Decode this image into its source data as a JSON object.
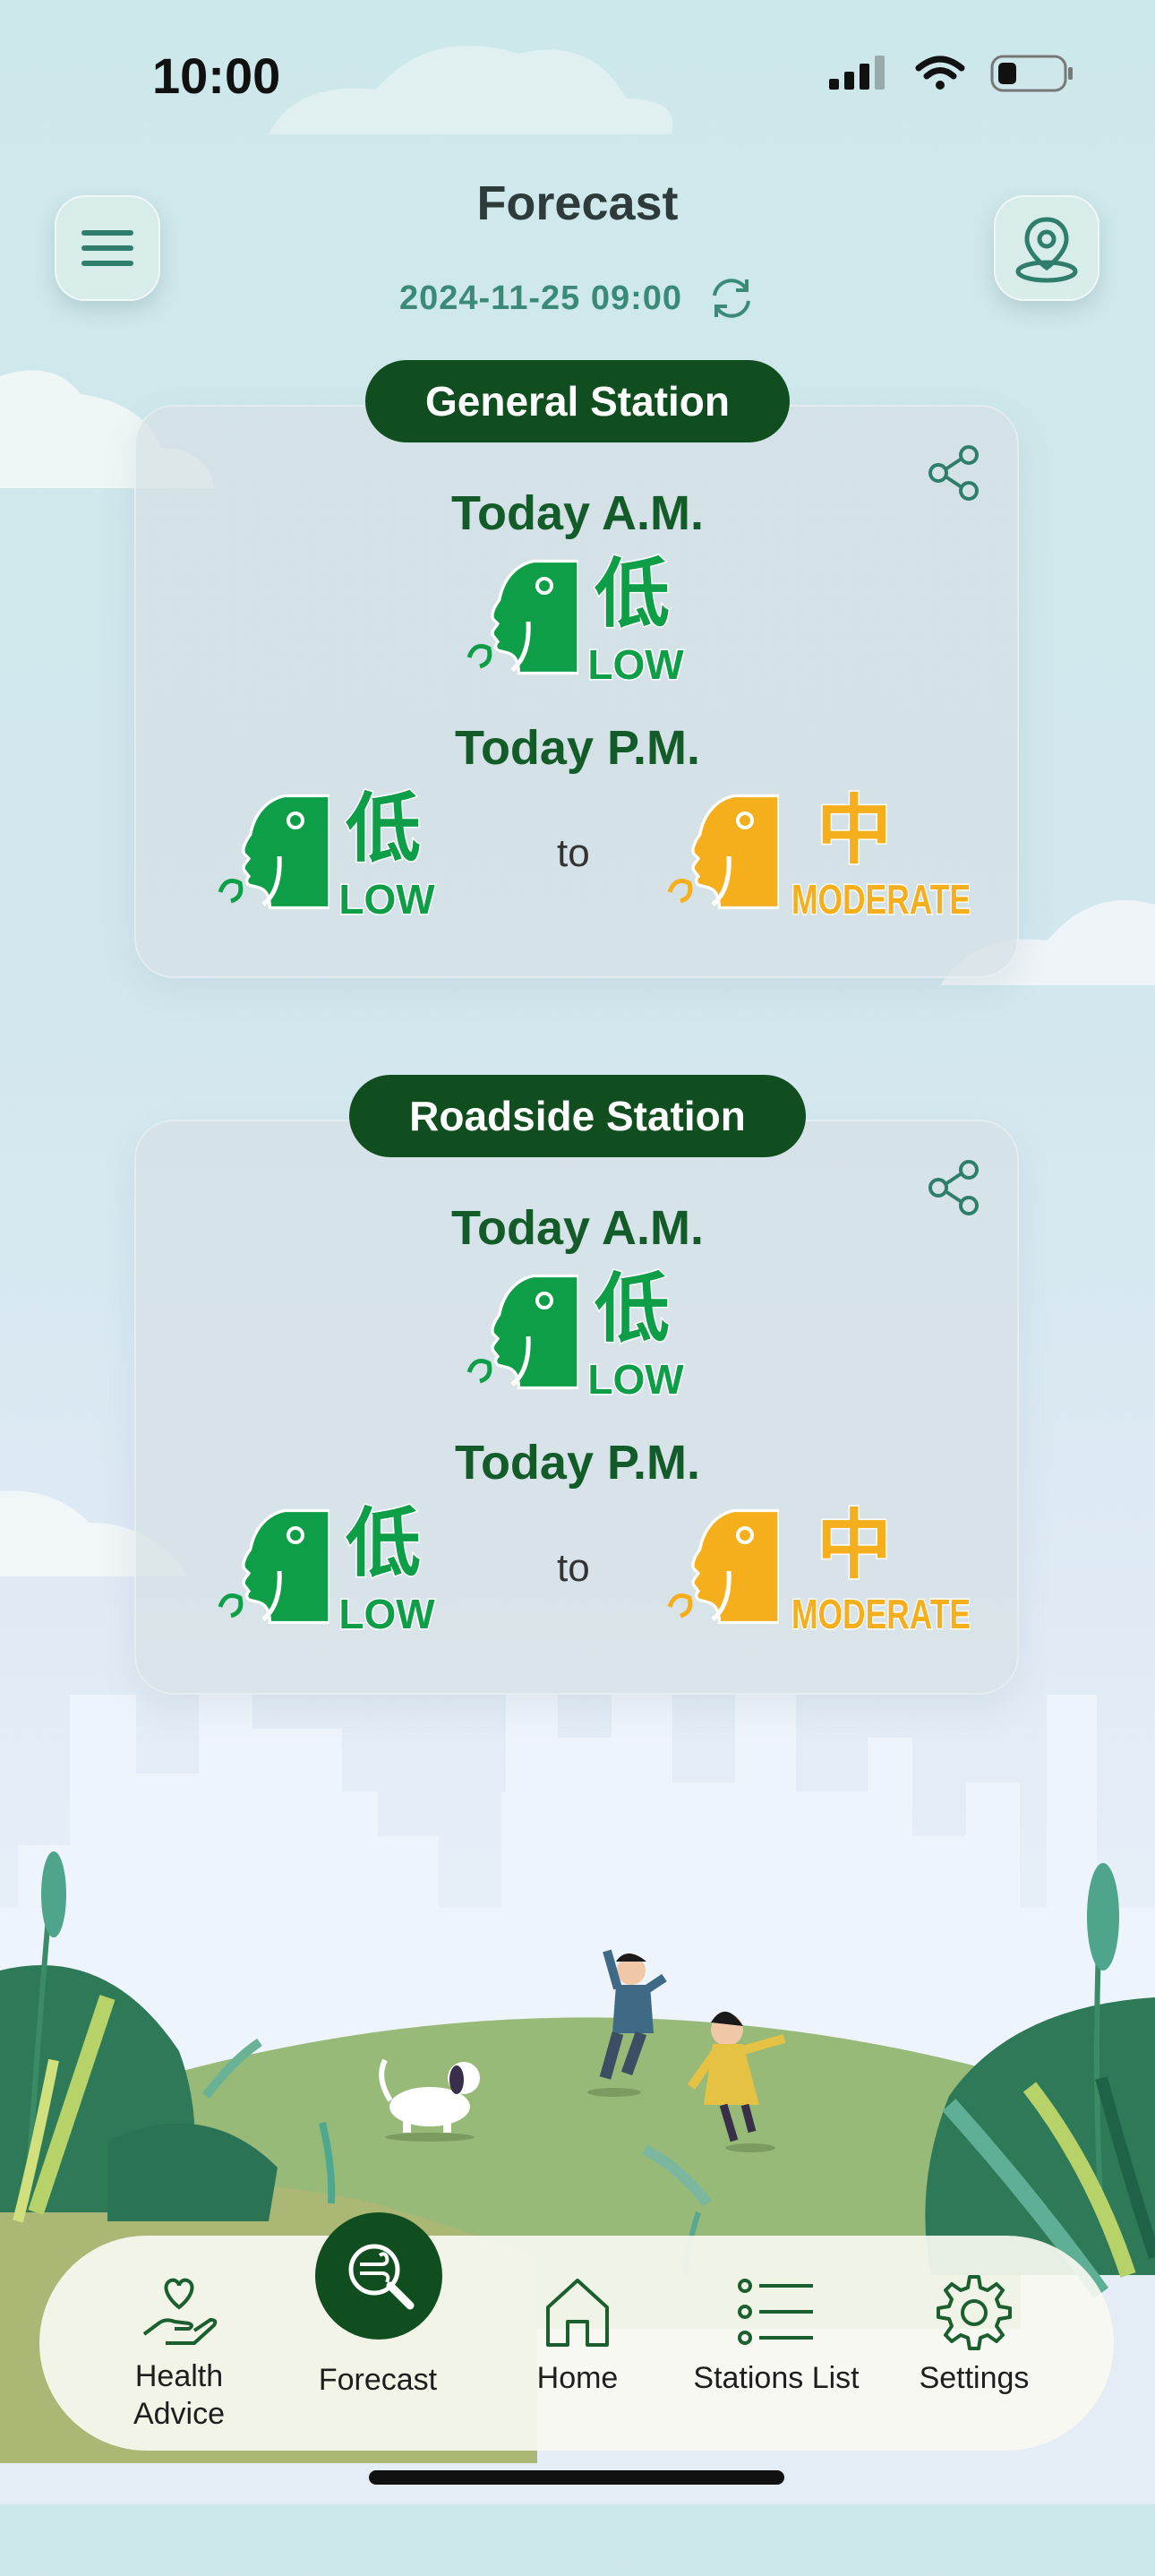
{
  "status_bar": {
    "time": "10:00"
  },
  "header": {
    "title": "Forecast",
    "datetime": "2024-11-25 09:00",
    "menu_icon": "hamburger-icon",
    "location_icon": "location-pin-icon",
    "refresh_icon": "refresh-icon"
  },
  "stations": [
    {
      "name": "General Station",
      "am_label": "Today A.M.",
      "am_level": {
        "char": "低",
        "text": "LOW",
        "color": "#0e9e47"
      },
      "pm_label": "Today P.M.",
      "pm_from": {
        "char": "低",
        "text": "LOW",
        "color": "#0e9e47"
      },
      "to_text": "to",
      "pm_to": {
        "char": "中",
        "text": "MODERATE",
        "color": "#f5ae1c"
      }
    },
    {
      "name": "Roadside Station",
      "am_label": "Today A.M.",
      "am_level": {
        "char": "低",
        "text": "LOW",
        "color": "#0e9e47"
      },
      "pm_label": "Today P.M.",
      "pm_from": {
        "char": "低",
        "text": "LOW",
        "color": "#0e9e47"
      },
      "to_text": "to",
      "pm_to": {
        "char": "中",
        "text": "MODERATE",
        "color": "#f5ae1c"
      }
    }
  ],
  "nav": {
    "items": [
      {
        "label": "Health\nAdvice",
        "icon": "hand-heart-icon"
      },
      {
        "label": "Forecast",
        "icon": "wind-search-icon",
        "active": true
      },
      {
        "label": "Home",
        "icon": "home-icon"
      },
      {
        "label": "Stations List",
        "icon": "list-icon"
      },
      {
        "label": "Settings",
        "icon": "gear-icon"
      }
    ]
  },
  "colors": {
    "dark_green": "#104d1f",
    "accent_green": "#3a8a77",
    "low_green": "#0e9e47",
    "moderate_orange": "#f5ae1c"
  }
}
